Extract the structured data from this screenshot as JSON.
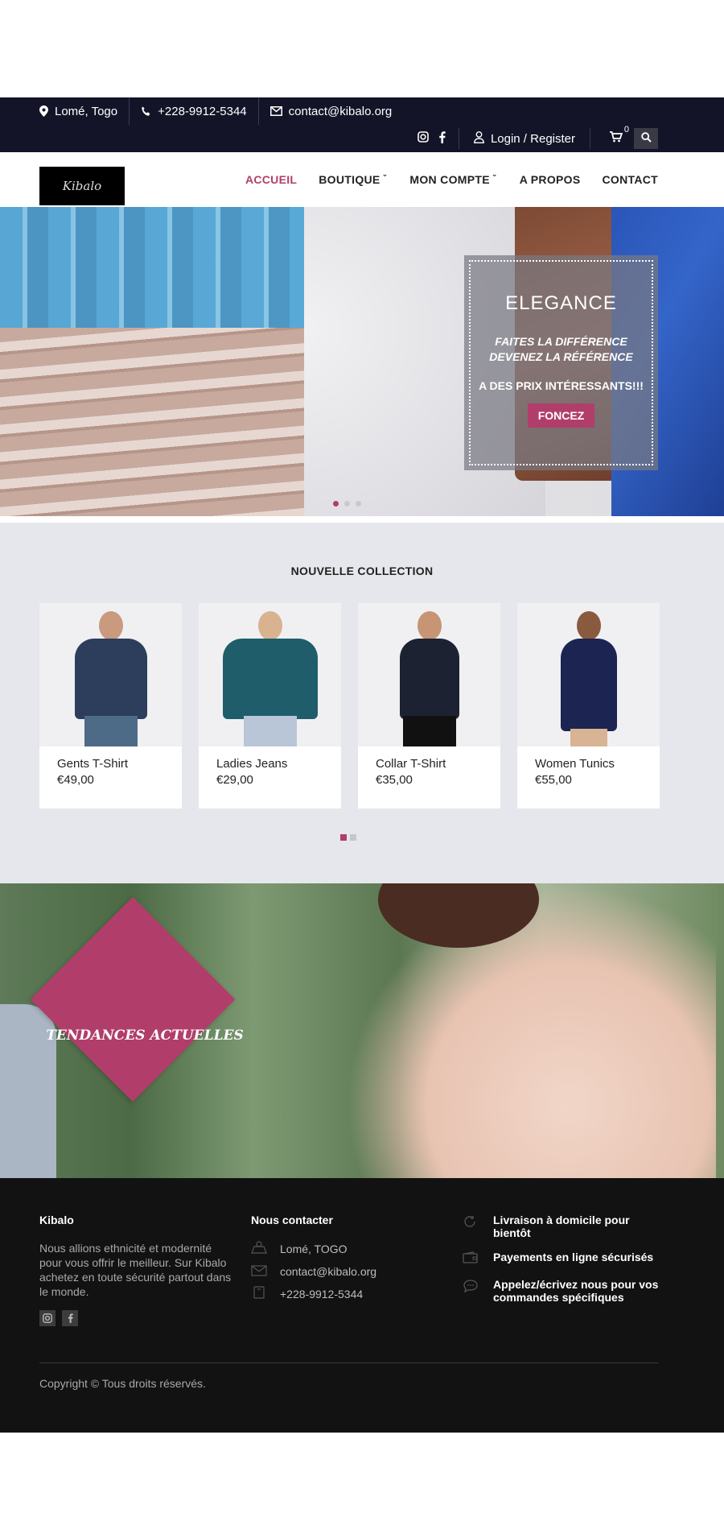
{
  "topbar": {
    "location": "Lomé, Togo",
    "phone": "+228-9912-5344",
    "email": "contact@kibalo.org",
    "login": "Login / Register",
    "cart_count": "0"
  },
  "nav": {
    "logo_text": "Kibalo",
    "items": [
      {
        "label": "ACCUEIL",
        "active": true
      },
      {
        "label": "BOUTIQUE",
        "dropdown": true
      },
      {
        "label": "MON COMPTE",
        "dropdown": true
      },
      {
        "label": "A PROPOS"
      },
      {
        "label": "CONTACT"
      }
    ],
    "accent": "#b13e6a"
  },
  "hero": {
    "title": "ELEGANCE",
    "line1": "FAITES LA DIFFÉRENCE",
    "line2": "DEVENEZ LA RÉFÉRENCE",
    "line3": "A DES PRIX  INTÉRESSANTS!!!",
    "button": "FONCEZ",
    "slides": 3,
    "active_slide": 1
  },
  "collection": {
    "title": "NOUVELLE COLLECTION",
    "products": [
      {
        "name": "Gents T-Shirt",
        "price": "€49,00"
      },
      {
        "name": "Ladies Jeans",
        "price": "€29,00"
      },
      {
        "name": "Collar T-Shirt",
        "price": "€35,00"
      },
      {
        "name": "Women Tunics",
        "price": "€55,00"
      }
    ],
    "pages": 2,
    "active_page": 1
  },
  "trends": {
    "label": "TENDANCES ACTUELLES"
  },
  "footer": {
    "about_title": "Kibalo",
    "about_text": "Nous allions ethnicité et modernité pour vous offrir le meilleur. Sur Kibalo achetez en toute sécurité partout dans le monde.",
    "contact_title": "Nous contacter",
    "contact_location": "Lomé, TOGO",
    "contact_email": "contact@kibalo.org",
    "contact_phone": "+228-9912-5344",
    "feature1": "Livraison à domicile pour bientôt",
    "feature2": "Payements en ligne sécurisés",
    "feature3": "Appelez/écrivez nous pour vos commandes spécifiques",
    "copyright": "Copyright © Tous droits réservés."
  }
}
